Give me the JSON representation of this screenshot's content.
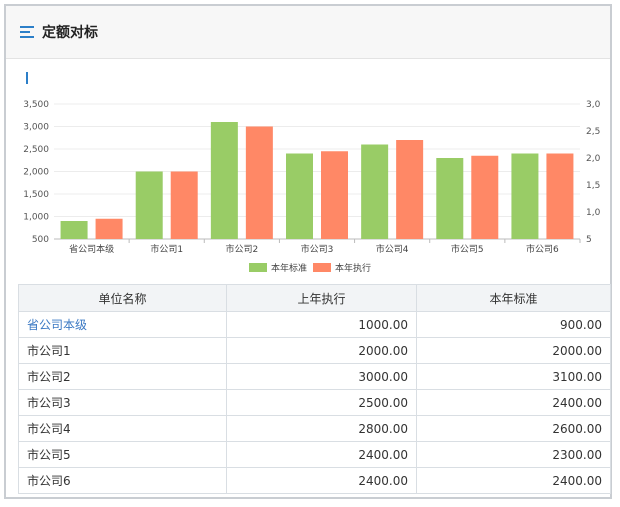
{
  "panel": {
    "title": "定额对标"
  },
  "colors": {
    "standard": "#99cc66",
    "execution": "#ff8866",
    "link": "#3a78c3"
  },
  "chart_data": {
    "type": "bar",
    "categories": [
      "省公司本级",
      "市公司1",
      "市公司2",
      "市公司3",
      "市公司4",
      "市公司5",
      "市公司6"
    ],
    "series": [
      {
        "name": "本年标准",
        "values": [
          900,
          2000,
          3100,
          2400,
          2600,
          2300,
          2400
        ]
      },
      {
        "name": "本年执行",
        "values": [
          950,
          2000,
          3000,
          2450,
          2700,
          2350,
          2400
        ]
      }
    ],
    "ylim": [
      500,
      3500
    ],
    "yticks": [
      "500",
      "1,000",
      "1,500",
      "2,000",
      "2,500",
      "3,000",
      "3,500"
    ],
    "y2ticks": [
      "5",
      "1,0",
      "1,5",
      "2,0",
      "2,5",
      "3,0"
    ],
    "grid": true,
    "legend": "bottom-center"
  },
  "table": {
    "headers": [
      "单位名称",
      "上年执行",
      "本年标准"
    ],
    "rows": [
      [
        "省公司本级",
        "1000.00",
        "900.00"
      ],
      [
        "市公司1",
        "2000.00",
        "2000.00"
      ],
      [
        "市公司2",
        "3000.00",
        "3100.00"
      ],
      [
        "市公司3",
        "2500.00",
        "2400.00"
      ],
      [
        "市公司4",
        "2800.00",
        "2600.00"
      ],
      [
        "市公司5",
        "2400.00",
        "2300.00"
      ],
      [
        "市公司6",
        "2400.00",
        "2400.00"
      ]
    ]
  }
}
